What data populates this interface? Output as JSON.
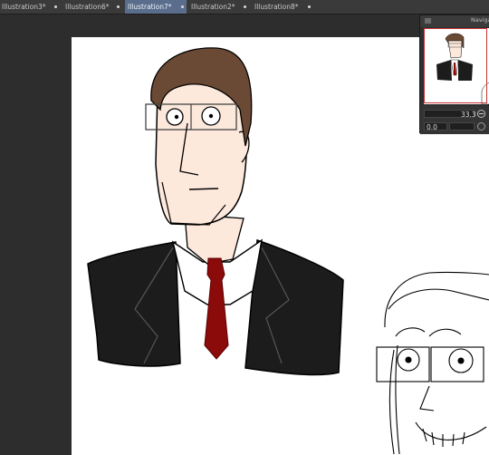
{
  "tabs": [
    {
      "label": "Illustration3*",
      "active": false
    },
    {
      "label": "Illustration6*",
      "active": false
    },
    {
      "label": "Illustration7*",
      "active": true
    },
    {
      "label": "Illustration2*",
      "active": false
    },
    {
      "label": "Illustration8*",
      "active": false
    }
  ],
  "navigator": {
    "title": "Navigat",
    "zoom_value": "33.3",
    "rotation_value": "0.0"
  },
  "colors": {
    "tab_active": "#5a6d8c",
    "tie": "#8b0a0a",
    "suit": "#1c1c1c",
    "hair": "#6b4a35",
    "skin": "#fde8dc",
    "nav_frame": "#c83232"
  }
}
